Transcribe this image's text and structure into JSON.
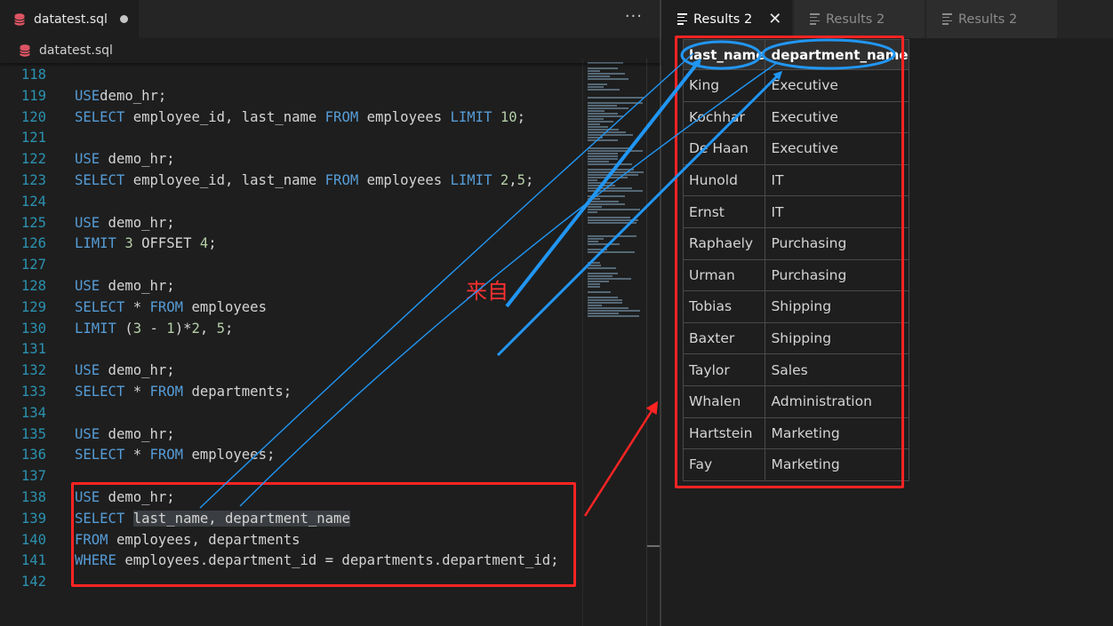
{
  "editor": {
    "tab": {
      "filename": "datatest.sql",
      "icon": "database-icon",
      "dirty_indicator": "unsaved-dot"
    },
    "more_actions": "···",
    "breadcrumb": "datatest.sql",
    "lines": [
      {
        "n": "118",
        "t": []
      },
      {
        "n": "119",
        "t": [
          [
            "kw",
            "USE"
          ],
          [
            "",
            "demo_hr;"
          ]
        ]
      },
      {
        "n": "120",
        "t": [
          [
            "kw",
            "SELECT"
          ],
          [
            "",
            " employee_id, last_name "
          ],
          [
            "kw",
            "FROM"
          ],
          [
            "",
            " employees "
          ],
          [
            "kw",
            "LIMIT"
          ],
          [
            "num",
            " 10"
          ],
          [
            "",
            ";"
          ]
        ]
      },
      {
        "n": "121",
        "t": []
      },
      {
        "n": "122",
        "t": [
          [
            "kw",
            "USE"
          ],
          [
            "",
            " demo_hr;"
          ]
        ]
      },
      {
        "n": "123",
        "t": [
          [
            "kw",
            "SELECT"
          ],
          [
            "",
            " employee_id, last_name "
          ],
          [
            "kw",
            "FROM"
          ],
          [
            "",
            " employees "
          ],
          [
            "kw",
            "LIMIT"
          ],
          [
            "num",
            " 2"
          ],
          [
            "",
            ","
          ],
          [
            "num",
            "5"
          ],
          [
            "",
            ";"
          ]
        ]
      },
      {
        "n": "124",
        "t": []
      },
      {
        "n": "125",
        "t": [
          [
            "kw",
            "USE"
          ],
          [
            "",
            " demo_hr;"
          ]
        ]
      },
      {
        "n": "126",
        "t": [
          [
            "kw",
            "LIMIT"
          ],
          [
            "num",
            " 3"
          ],
          [
            "",
            " OFFSET "
          ],
          [
            "num",
            "4"
          ],
          [
            "",
            ";"
          ]
        ]
      },
      {
        "n": "127",
        "t": []
      },
      {
        "n": "128",
        "t": [
          [
            "kw",
            "USE"
          ],
          [
            "",
            " demo_hr;"
          ]
        ]
      },
      {
        "n": "129",
        "t": [
          [
            "kw",
            "SELECT"
          ],
          [
            "",
            " * "
          ],
          [
            "kw",
            "FROM"
          ],
          [
            "",
            " employees"
          ]
        ]
      },
      {
        "n": "130",
        "t": [
          [
            "kw",
            "LIMIT"
          ],
          [
            "",
            " ("
          ],
          [
            "num",
            "3"
          ],
          [
            "",
            " - "
          ],
          [
            "num",
            "1"
          ],
          [
            "",
            ")*"
          ],
          [
            "num",
            "2"
          ],
          [
            "",
            ", "
          ],
          [
            "num",
            "5"
          ],
          [
            "",
            ";"
          ]
        ]
      },
      {
        "n": "131",
        "t": []
      },
      {
        "n": "132",
        "t": [
          [
            "kw",
            "USE"
          ],
          [
            "",
            " demo_hr;"
          ]
        ]
      },
      {
        "n": "133",
        "t": [
          [
            "kw",
            "SELECT"
          ],
          [
            "",
            " * "
          ],
          [
            "kw",
            "FROM"
          ],
          [
            "",
            " departments;"
          ]
        ]
      },
      {
        "n": "134",
        "t": []
      },
      {
        "n": "135",
        "t": [
          [
            "kw",
            "USE"
          ],
          [
            "",
            " demo_hr;"
          ]
        ]
      },
      {
        "n": "136",
        "t": [
          [
            "kw",
            "SELECT"
          ],
          [
            "",
            " * "
          ],
          [
            "kw",
            "FROM"
          ],
          [
            "",
            " employees;"
          ]
        ]
      },
      {
        "n": "137",
        "t": []
      },
      {
        "n": "138",
        "t": [
          [
            "kw",
            "USE"
          ],
          [
            "",
            " demo_hr;"
          ]
        ]
      },
      {
        "n": "139",
        "t": [
          [
            "kw",
            "SELECT"
          ],
          [
            "",
            " "
          ],
          [
            "hl",
            "last_name, department_name"
          ]
        ]
      },
      {
        "n": "140",
        "t": [
          [
            "kw",
            "FROM"
          ],
          [
            "",
            " employees, departments"
          ]
        ]
      },
      {
        "n": "141",
        "t": [
          [
            "kw",
            "WHERE"
          ],
          [
            "",
            " employees.department_id = departments.department_id;"
          ]
        ]
      },
      {
        "n": "142",
        "t": []
      }
    ]
  },
  "results": {
    "tabs": [
      {
        "label": "Results 2",
        "active": true,
        "closable": true
      },
      {
        "label": "Results 2",
        "active": false
      },
      {
        "label": "Results 2",
        "active": false
      }
    ],
    "close_label": "✕",
    "columns": [
      "last_name",
      "department_name"
    ],
    "rows": [
      [
        "King",
        "Executive"
      ],
      [
        "Kochhar",
        "Executive"
      ],
      [
        "De Haan",
        "Executive"
      ],
      [
        "Hunold",
        "IT"
      ],
      [
        "Ernst",
        "IT"
      ],
      [
        "Raphaely",
        "Purchasing"
      ],
      [
        "Urman",
        "Purchasing"
      ],
      [
        "Tobias",
        "Shipping"
      ],
      [
        "Baxter",
        "Shipping"
      ],
      [
        "Taylor",
        "Sales"
      ],
      [
        "Whalen",
        "Administration"
      ],
      [
        "Hartstein",
        "Marketing"
      ],
      [
        "Fay",
        "Marketing"
      ]
    ]
  },
  "annotation": {
    "text": "来自",
    "color_red": "#ff2424",
    "color_blue": "#2196f3"
  }
}
